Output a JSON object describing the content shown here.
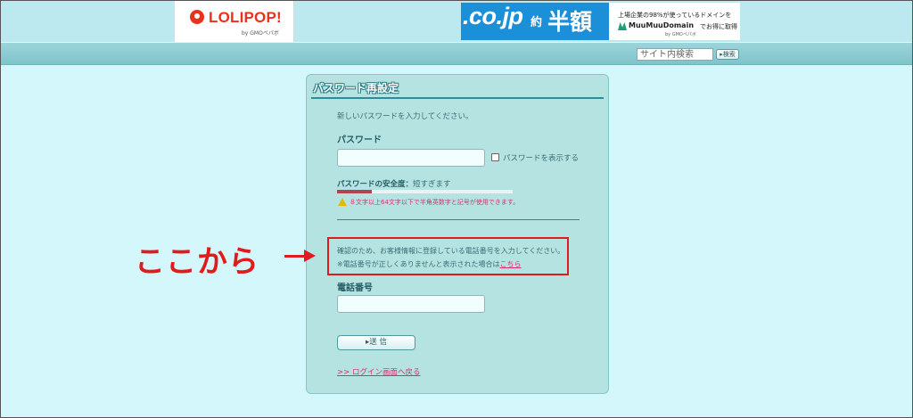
{
  "header": {
    "logo_text": "LOLIPOP!",
    "logo_sub": "by GMOペパボ",
    "ad": {
      "domain": ".co.jp",
      "yaku": "約",
      "half": "半額",
      "line1": "上場企業の98%が使っているドメインを",
      "brand": "MuuMuuDomain",
      "note": "でお得に取得",
      "gmo": "by GMOペパボ"
    }
  },
  "nav": {
    "search_placeholder": "サイト内検索",
    "search_button": "▸検索"
  },
  "form": {
    "title": "パスワード再設定",
    "intro": "新しいパスワードを入力してください。",
    "password_label": "パスワード",
    "show_password_label": "パスワードを表示する",
    "strength_label": "パスワードの安全度：",
    "strength_value": "短すぎます",
    "strength_fraction": 0.2,
    "warning": "８文字以上64文字以下で半角英数字と記号が使用できます。",
    "confirm_line1": "確認のため、お客様情報に登録している電話番号を入力してください。",
    "confirm_line2": "※電話番号が正しくありませんと表示された場合は",
    "here_link": "こちら",
    "phone_label": "電話番号",
    "submit": "▸送 信",
    "back_link": ">> ログイン画面へ戻る"
  },
  "annotation": {
    "text": "ここから"
  },
  "colors": {
    "background": "#d3f7fa",
    "panel": "#b4e3e2",
    "link": "#d8326e",
    "annotation": "#e01b1b"
  }
}
